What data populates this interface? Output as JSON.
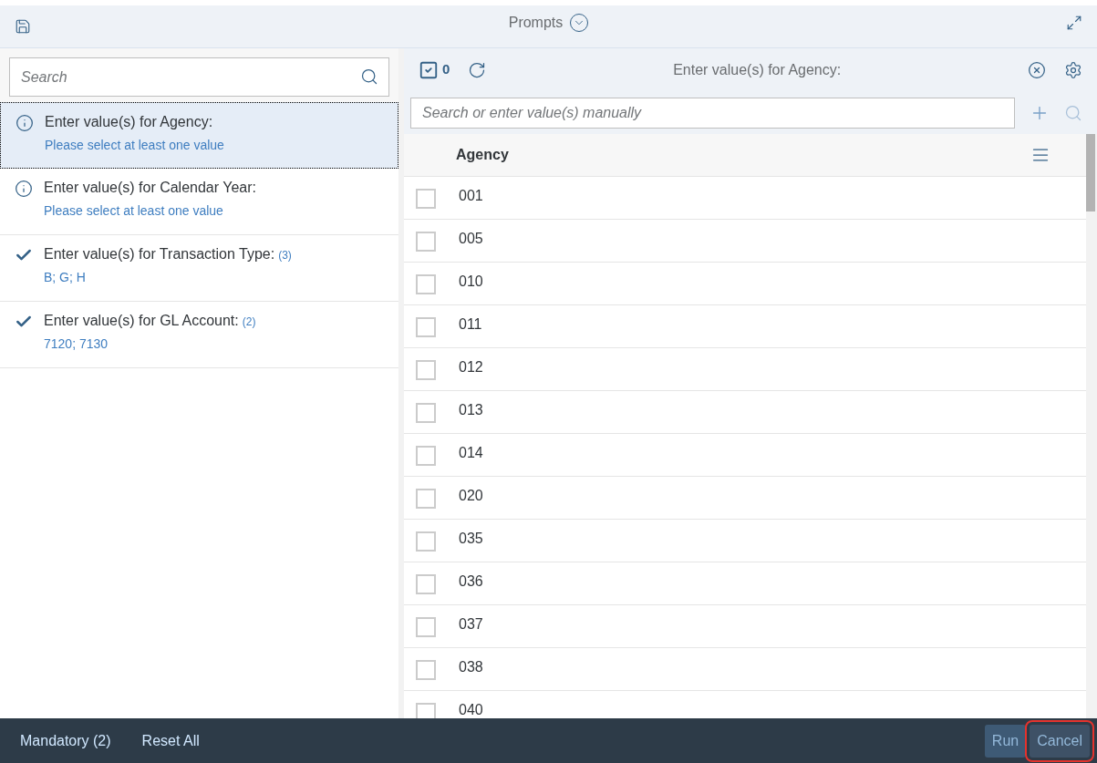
{
  "header": {
    "title": "Prompts"
  },
  "sidebar": {
    "search": {
      "placeholder": "Search"
    },
    "items": [
      {
        "kind": "info",
        "label": "Enter value(s) for Agency:",
        "detail": "Please select at least one value",
        "selected": true
      },
      {
        "kind": "info",
        "label": "Enter value(s) for Calendar Year:",
        "detail": "Please select at least one value",
        "selected": false
      },
      {
        "kind": "done",
        "label": "Enter value(s) for Transaction Type:",
        "count": "(3)",
        "detail": "B; G; H",
        "selected": false
      },
      {
        "kind": "done",
        "label": "Enter value(s) for GL Account:",
        "count": "(2)",
        "detail": "7120; 7130",
        "selected": false
      }
    ]
  },
  "panel": {
    "selected_count": "0",
    "title": "Enter value(s) for Agency:",
    "search": {
      "placeholder": "Search or enter value(s) manually"
    },
    "table": {
      "column": "Agency",
      "rows": [
        {
          "value": "001",
          "checked": false
        },
        {
          "value": "005",
          "checked": false
        },
        {
          "value": "010",
          "checked": false
        },
        {
          "value": "011",
          "checked": false
        },
        {
          "value": "012",
          "checked": false
        },
        {
          "value": "013",
          "checked": false
        },
        {
          "value": "014",
          "checked": false
        },
        {
          "value": "020",
          "checked": false
        },
        {
          "value": "035",
          "checked": false
        },
        {
          "value": "036",
          "checked": false
        },
        {
          "value": "037",
          "checked": false
        },
        {
          "value": "038",
          "checked": false
        },
        {
          "value": "040",
          "checked": false
        }
      ]
    }
  },
  "footer": {
    "links": [
      "Mandatory (2)",
      "Reset All"
    ],
    "buttons": [
      {
        "label": "Run",
        "highlighted": false
      },
      {
        "label": "Cancel",
        "highlighted": true
      }
    ]
  }
}
